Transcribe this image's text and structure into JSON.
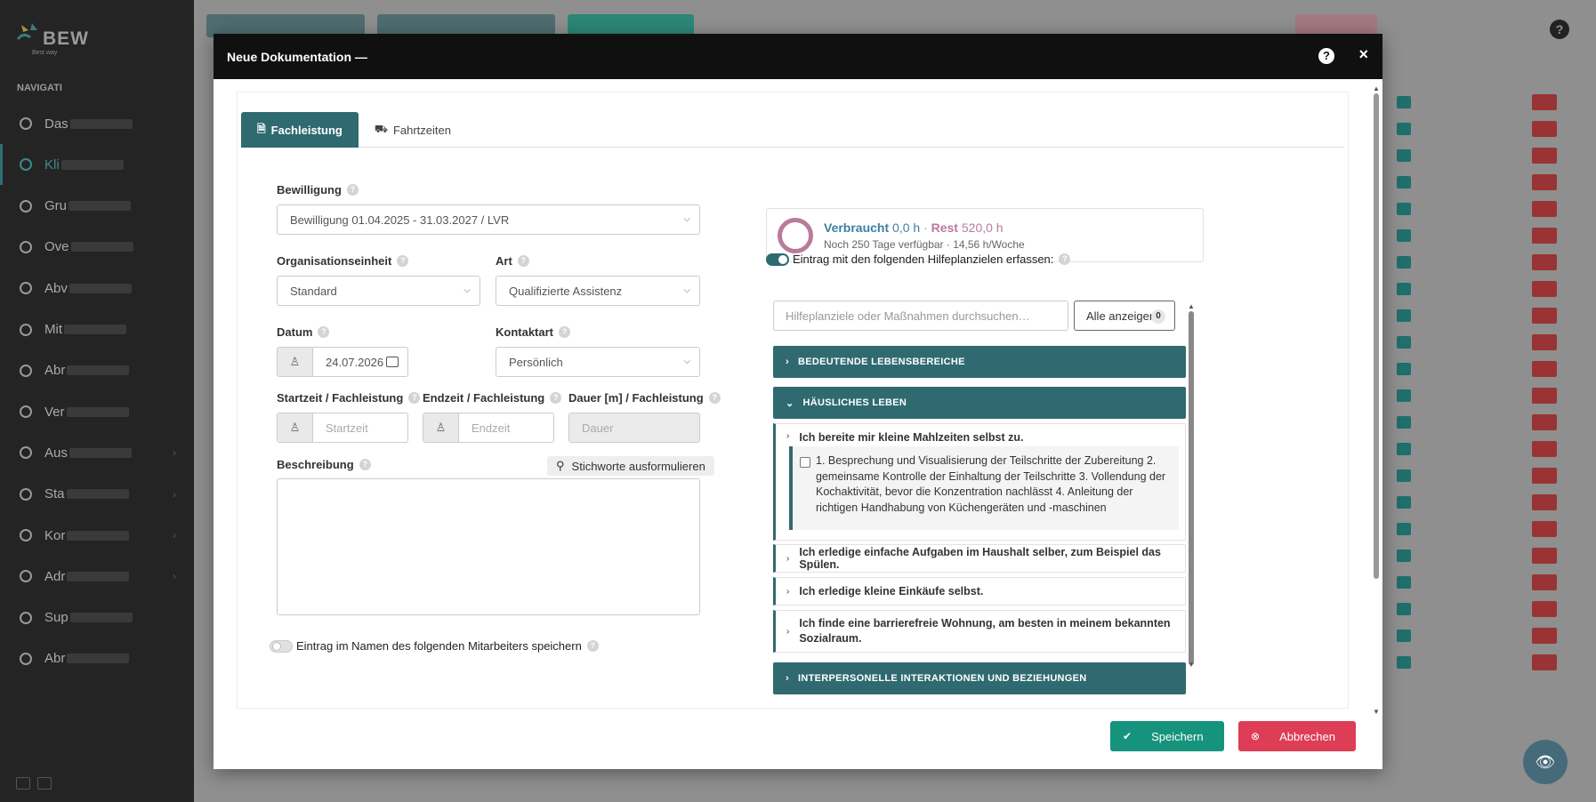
{
  "app": {
    "logo_text": "BEW",
    "logo_sub": "Best way",
    "nav_title": "NAVIGATI",
    "nav_items": [
      {
        "label": "Das",
        "icon": "dashboard-icon"
      },
      {
        "label": "Kli",
        "icon": "user-icon"
      },
      {
        "label": "Gru",
        "icon": "group-icon"
      },
      {
        "label": "Ove",
        "icon": "clock-icon"
      },
      {
        "label": "Abv",
        "icon": "calendar-icon"
      },
      {
        "label": "Mit",
        "icon": "users-icon"
      },
      {
        "label": "Abr",
        "icon": "money-icon"
      },
      {
        "label": "Ver",
        "icon": "history-icon"
      },
      {
        "label": "Aus",
        "icon": "document-icon"
      },
      {
        "label": "Sta",
        "icon": "edit-icon"
      },
      {
        "label": "Kor",
        "icon": "edit-icon"
      },
      {
        "label": "Adr",
        "icon": "edit-icon"
      },
      {
        "label": "Sup",
        "icon": "help-icon"
      },
      {
        "label": "Abr",
        "icon": "power-icon"
      }
    ]
  },
  "modal": {
    "title": "Neue Dokumentation —",
    "help_label": "?",
    "close_label": "×",
    "tabs": [
      {
        "label": "Fachleistung",
        "icon": "document-icon"
      },
      {
        "label": "Fahrtzeiten",
        "icon": "car-icon"
      }
    ],
    "form": {
      "bewilligung_label": "Bewilligung",
      "bewilligung_value": "Bewilligung 01.04.2025 - 31.03.2027 / LVR",
      "org_label": "Organisationseinheit",
      "org_value": "Standard",
      "art_label": "Art",
      "art_value": "Qualifizierte Assistenz",
      "datum_label": "Datum",
      "datum_value": "24.07.2026",
      "kontakt_label": "Kontaktart",
      "kontakt_value": "Persönlich",
      "start_label": "Startzeit / Fachleistung",
      "start_placeholder": "Startzeit",
      "end_label": "Endzeit / Fachleistung",
      "end_placeholder": "Endzeit",
      "dauer_label": "Dauer [m] / Fachleistung",
      "dauer_placeholder": "Dauer",
      "beschreibung_label": "Beschreibung",
      "stichworte_label": "Stichworte ausformulieren",
      "mitarbeiter_toggle_label": "Eintrag im Namen des folgenden Mitarbeiters speichern"
    },
    "budget": {
      "used_label": "Verbraucht",
      "used_value": "0,0 h",
      "separator": "·",
      "rest_label": "Rest",
      "rest_value": "520,0 h",
      "sub": "Noch 250 Tage verfügbar · 14,56 h/Woche"
    },
    "goals": {
      "toggle_label": "Eintrag mit den folgenden Hilfeplanzielen erfassen:",
      "search_placeholder": "Hilfeplanziele oder Maßnahmen durchsuchen…",
      "show_all_label": "Alle anzeigen",
      "show_all_count": "0",
      "categories": [
        "BEDEUTENDE LEBENSBEREICHE",
        "HÄUSLICHES LEBEN",
        "INTERPERSONELLE INTERAKTIONEN UND BEZIEHUNGEN"
      ],
      "items": [
        "Ich bereite mir kleine Mahlzeiten selbst zu.",
        "Ich erledige einfache Aufgaben im Haushalt selber, zum Beispiel das Spülen.",
        "Ich erledige kleine Einkäufe selbst.",
        "Ich finde eine barrierefreie Wohnung, am besten in meinem bekannten Sozialraum."
      ],
      "measure": "1. Besprechung und Visualisierung der Teilschritte der Zubereitung 2. gemeinsame Kontrolle der Einhaltung der Teilschritte 3. Vollendung der Kochaktivität, bevor die Konzentration nachlässt 4. Anleitung der richtigen Handhabung von Küchengeräten und -maschinen"
    },
    "footer": {
      "save_label": "Speichern",
      "cancel_label": "Abbrechen"
    }
  },
  "colors": {
    "accent": "#2f6a70",
    "save": "#16937d",
    "cancel": "#dd3d55",
    "used": "#3f7f9f",
    "rest": "#b97b9c"
  }
}
